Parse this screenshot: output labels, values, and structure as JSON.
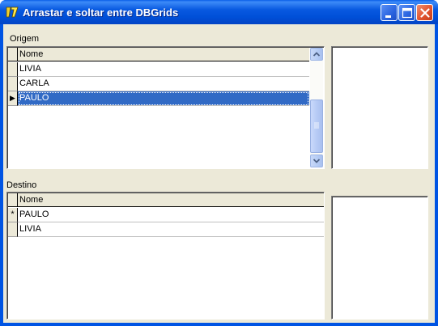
{
  "window": {
    "title": "Arrastar e soltar entre DBGrids",
    "icon": "delphi-app-icon",
    "minimize_icon": "minimize-icon",
    "maximize_icon": "maximize-icon",
    "close_icon": "close-icon"
  },
  "origem": {
    "label": "Origem",
    "column_header": "Nome",
    "rows": [
      {
        "value": "LIVIA",
        "indicator": ""
      },
      {
        "value": "CARLA",
        "indicator": ""
      },
      {
        "value": "PAULO",
        "indicator": "▶",
        "selected": true
      }
    ]
  },
  "destino": {
    "label": "Destino",
    "column_header": "Nome",
    "rows": [
      {
        "value": "PAULO",
        "indicator": "*"
      },
      {
        "value": "LIVIA",
        "indicator": ""
      }
    ]
  },
  "colors": {
    "titlebar": "#0054e3",
    "selection": "#316ac5",
    "face": "#ece9d8"
  }
}
